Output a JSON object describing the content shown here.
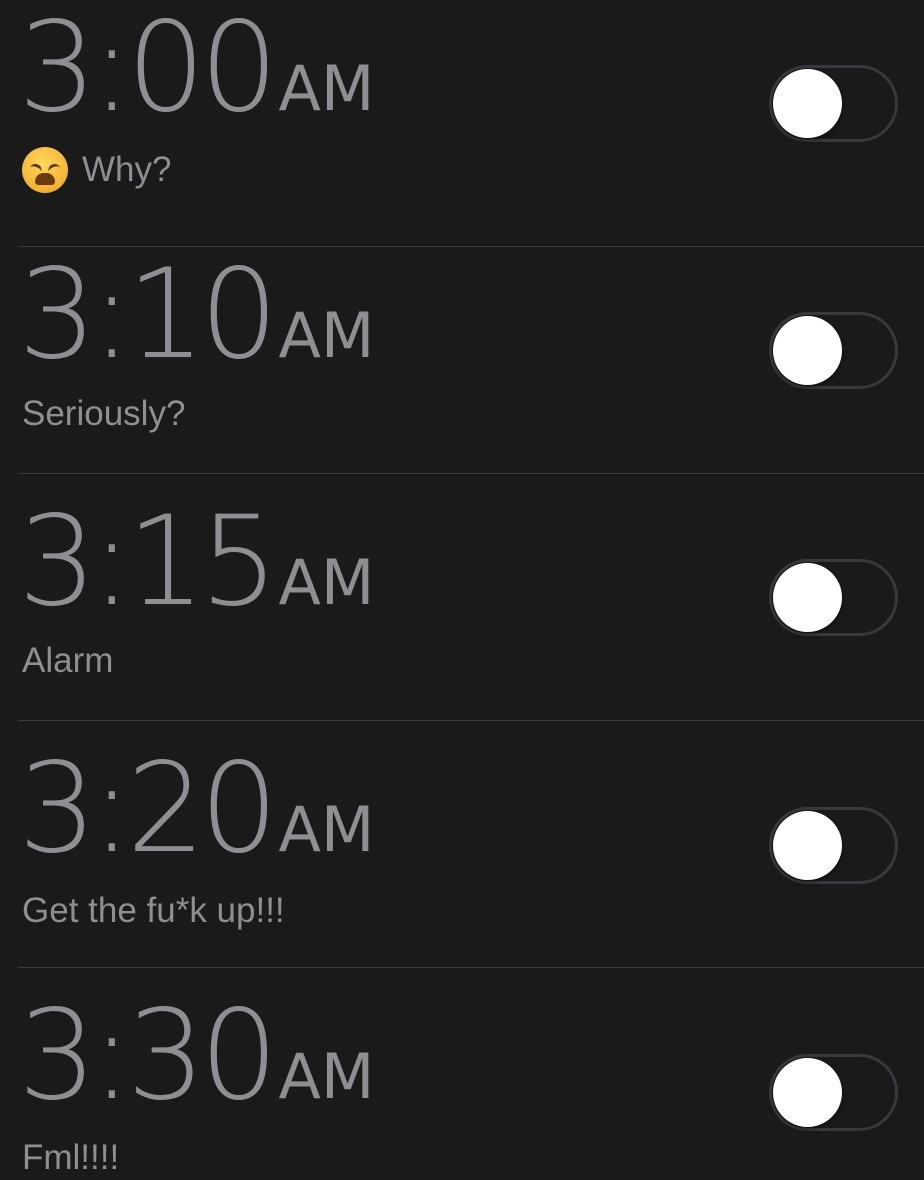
{
  "alarms": [
    {
      "time": "3:00",
      "period": "AM",
      "label": "Why?",
      "emoji": "weary-face-icon",
      "enabled": false
    },
    {
      "time": "3:10",
      "period": "AM",
      "label": "Seriously?",
      "enabled": false
    },
    {
      "time": "3:15",
      "period": "AM",
      "label": "Alarm",
      "enabled": false
    },
    {
      "time": "3:20",
      "period": "AM",
      "label": "Get the fu*k up!!!",
      "enabled": false
    },
    {
      "time": "3:30",
      "period": "AM",
      "label": "Fml!!!!",
      "enabled": false
    }
  ],
  "colors": {
    "background": "#1a1a1b",
    "text": "#8e8e93",
    "divider": "#3a3a3c",
    "toggle_track": "#39393d",
    "toggle_knob": "#ffffff"
  }
}
